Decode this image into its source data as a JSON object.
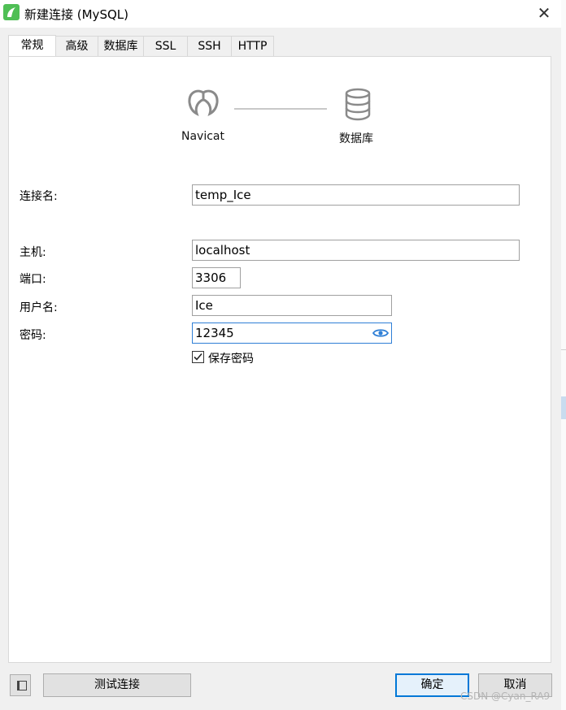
{
  "window": {
    "title": "新建连接 (MySQL)",
    "close_glyph": "✕"
  },
  "tabs": [
    {
      "label": "常规",
      "active": true
    },
    {
      "label": "高级"
    },
    {
      "label": "数据库"
    },
    {
      "label": "SSL"
    },
    {
      "label": "SSH"
    },
    {
      "label": "HTTP"
    }
  ],
  "diagram": {
    "left_label": "Navicat",
    "right_label": "数据库",
    "left_icon": "navicat-logo-icon",
    "right_icon": "database-icon"
  },
  "form": {
    "connection_name_label": "连接名:",
    "connection_name_value": "temp_Ice",
    "host_label": "主机:",
    "host_value": "localhost",
    "port_label": "端口:",
    "port_value": "3306",
    "username_label": "用户名:",
    "username_value": "Ice",
    "password_label": "密码:",
    "password_value": "12345",
    "save_password_label": "保存密码",
    "save_password_checked": true
  },
  "buttons": {
    "test_connection": "测试连接",
    "ok": "确定",
    "cancel": "取消"
  },
  "watermark": "CSDN @Cyan_RA9",
  "colors": {
    "accent": "#0078d7",
    "app_icon": "#4fbf55",
    "eye_icon": "#2f7fd6"
  }
}
